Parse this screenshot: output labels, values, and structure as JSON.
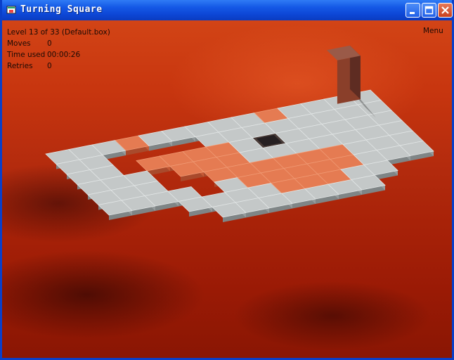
{
  "window": {
    "title": "Turning Square",
    "controls": [
      "minimize-icon",
      "maximize-icon",
      "close-icon"
    ]
  },
  "hud": {
    "level_text": "Level 13 of 33 (Default.box)",
    "moves_label": "Moves",
    "moves_value": "0",
    "time_label": "Time used",
    "time_value": "00:00:26",
    "retries_label": "Retries",
    "retries_value": "0"
  },
  "menu_label": "Menu",
  "colors": {
    "grey_tile": "#c4c8c8",
    "orange_tile": "#e57b52",
    "block": "#7a3a28"
  },
  "board": {
    "tile_types": [
      "grey",
      "orange",
      "goal-hole",
      "player-block"
    ]
  }
}
